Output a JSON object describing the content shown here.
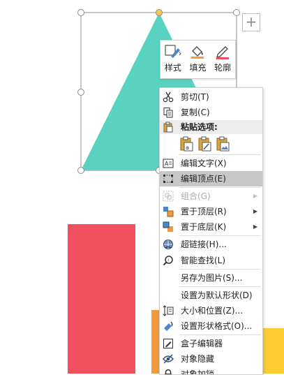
{
  "canvas": {
    "plus_label": "+"
  },
  "mini_toolbar": {
    "buttons": [
      {
        "label": "样式",
        "icon": "style-brush-icon"
      },
      {
        "label": "填充",
        "icon": "fill-bucket-icon"
      },
      {
        "label": "轮廓",
        "icon": "outline-pen-icon"
      }
    ]
  },
  "context_menu": {
    "items": [
      {
        "label": "剪切(T)",
        "icon": "scissors-icon",
        "enabled": true
      },
      {
        "label": "复制(C)",
        "icon": "copy-icon",
        "enabled": true
      },
      {
        "label": "编辑文字(X)",
        "icon": "edit-text-icon",
        "enabled": true
      },
      {
        "label": "编辑顶点(E)",
        "icon": "edit-points-icon",
        "enabled": true,
        "highlighted": true
      },
      {
        "label": "组合(G)",
        "icon": "group-icon",
        "enabled": false,
        "submenu": true
      },
      {
        "label": "置于顶层(R)",
        "icon": "bring-to-front-icon",
        "enabled": true,
        "submenu": true
      },
      {
        "label": "置于底层(K)",
        "icon": "send-to-back-icon",
        "enabled": true,
        "submenu": true
      },
      {
        "label": "超链接(H)...",
        "icon": "hyperlink-icon",
        "enabled": true
      },
      {
        "label": "智能查找(L)",
        "icon": "smart-lookup-icon",
        "enabled": true
      },
      {
        "label": "另存为图片(S)...",
        "icon": "",
        "enabled": true
      },
      {
        "label": "设置为默认形状(D)",
        "icon": "",
        "enabled": true
      },
      {
        "label": "大小和位置(Z)...",
        "icon": "size-position-icon",
        "enabled": true
      },
      {
        "label": "设置形状格式(O)...",
        "icon": "format-shape-icon",
        "enabled": true
      },
      {
        "label": "盒子编辑器",
        "icon": "box-editor-icon",
        "enabled": true
      },
      {
        "label": "对象隐藏",
        "icon": "hide-eye-icon",
        "enabled": true
      },
      {
        "label": "对象加锁",
        "icon": "lock-icon",
        "enabled": true
      }
    ],
    "paste_header": "粘贴选项:",
    "paste_options": [
      "paste-keep-formatting-icon",
      "paste-format-icon",
      "paste-picture-icon"
    ]
  },
  "colors": {
    "triangle": "#5ad2c2",
    "red_rect": "#f0505e",
    "orange_strip": "#f29a3c",
    "yellow_rect": "#ffcc33",
    "highlight": "#c7c7c7"
  }
}
